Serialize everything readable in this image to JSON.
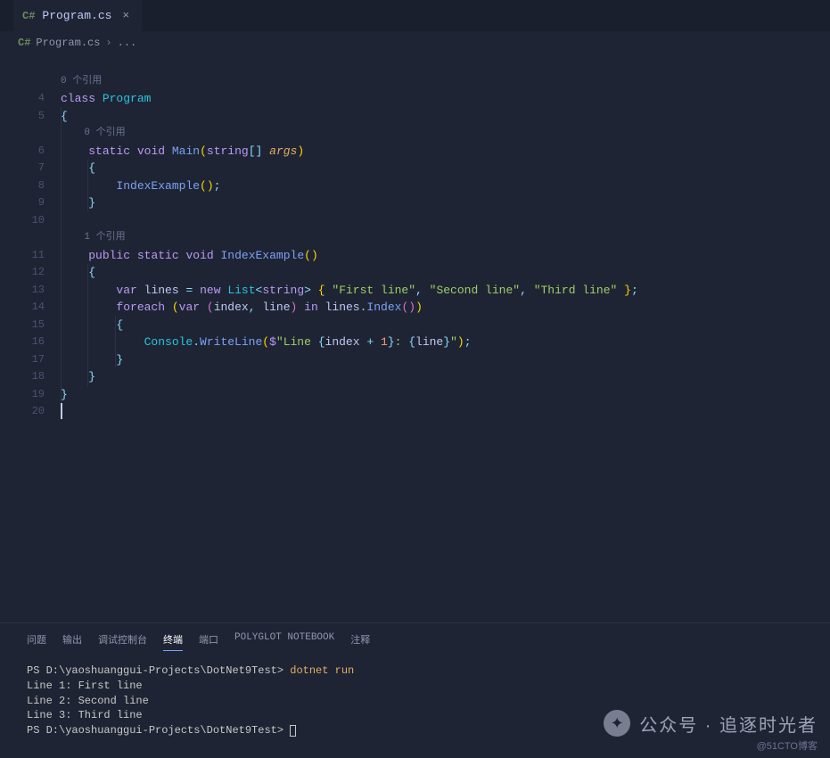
{
  "tab": {
    "icon_label": "C#",
    "filename": "Program.cs"
  },
  "breadcrumb": {
    "icon_label": "C#",
    "filename": "Program.cs",
    "separator": "›",
    "rest": "..."
  },
  "gutter": {
    "start_blank": "",
    "lines": [
      "4",
      "5",
      "6",
      "7",
      "8",
      "9",
      "10",
      "11",
      "12",
      "13",
      "14",
      "15",
      "16",
      "17",
      "18",
      "19",
      "20"
    ]
  },
  "codelens": {
    "ref0": "0 个引用",
    "ref0b": "0 个引用",
    "ref1": "1 个引用"
  },
  "code": {
    "l4": {
      "kw_class": "class",
      "name": "Program"
    },
    "l5": {
      "brace": "{"
    },
    "l6": {
      "kw_static": "static",
      "kw_void": "void",
      "fn": "Main",
      "lp": "(",
      "type": "string",
      "arr": "[]",
      "param": "args",
      "rp": ")"
    },
    "l7": {
      "brace": "{"
    },
    "l8": {
      "fn": "IndexExample",
      "lp": "(",
      "rp": ")",
      "semi": ";"
    },
    "l9": {
      "brace": "}"
    },
    "l11": {
      "kw_public": "public",
      "kw_static": "static",
      "kw_void": "void",
      "fn": "IndexExample",
      "lp": "(",
      "rp": ")"
    },
    "l12": {
      "brace": "{"
    },
    "l13": {
      "kw_var": "var",
      "name": "lines",
      "eq": "=",
      "kw_new": "new",
      "type": "List",
      "lt": "<",
      "gtype": "string",
      "gt": ">",
      "lb": "{",
      "s1": "\"First line\"",
      "c": ",",
      "s2": "\"Second line\"",
      "s3": "\"Third line\"",
      "rb": "}",
      "semi": ";"
    },
    "l14": {
      "kw_foreach": "foreach",
      "lp1": "(",
      "kw_var": "var",
      "lp2": "(",
      "v1": "index",
      "c": ",",
      "v2": "line",
      "rp2": ")",
      "kw_in": "in",
      "obj": "lines",
      "dot": ".",
      "fn": "Index",
      "lp3": "(",
      "rp3": ")",
      "rp1": ")"
    },
    "l15": {
      "brace": "{"
    },
    "l16": {
      "obj": "Console",
      "dot": ".",
      "fn": "WriteLine",
      "lp": "(",
      "dollar": "$",
      "q1": "\"",
      "t1": "Line ",
      "lb1": "{",
      "v1": "index",
      "plus": "+",
      "n1": "1",
      "rb1": "}",
      "t2": ": ",
      "lb2": "{",
      "v2": "line",
      "rb2": "}",
      "q2": "\"",
      "rp": ")",
      "semi": ";"
    },
    "l17": {
      "brace": "}"
    },
    "l18": {
      "brace": "}"
    },
    "l19": {
      "brace": "}"
    }
  },
  "terminal": {
    "tabs": {
      "problems": "问题",
      "output": "输出",
      "debug": "调试控制台",
      "terminal": "终端",
      "ports": "端口",
      "polyglot": "POLYGLOT NOTEBOOK",
      "comments": "注释"
    },
    "lines": {
      "prompt1_path": "PS D:\\yaoshuanggui-Projects\\DotNet9Test> ",
      "cmd": "dotnet run",
      "out1": "Line 1: First line",
      "out2": "Line 2: Second line",
      "out3": "Line 3: Third line",
      "prompt2_path": "PS D:\\yaoshuanggui-Projects\\DotNet9Test> "
    }
  },
  "watermark": {
    "text": "公众号 · 追逐时光者",
    "sub": "@51CTO博客"
  }
}
